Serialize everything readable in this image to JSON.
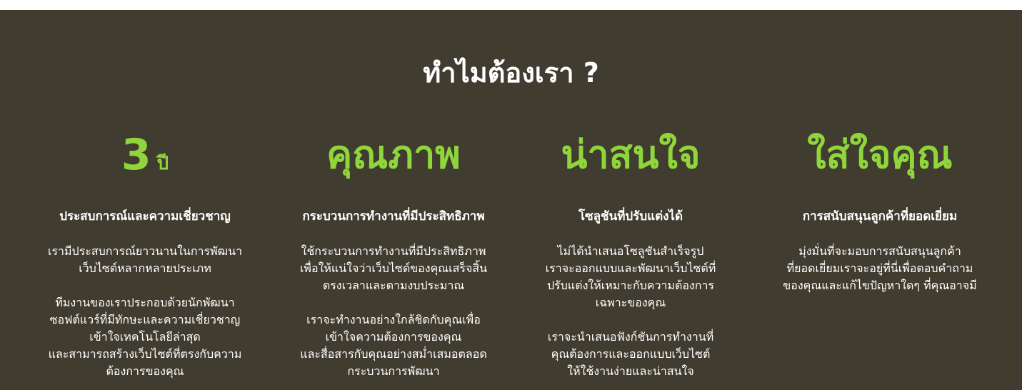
{
  "section": {
    "title": "ทำไมต้องเรา ?",
    "accent_color": "#8fd53b",
    "background_color": "#403c30"
  },
  "columns": [
    {
      "highlight_number": "3",
      "highlight_unit": "ปี",
      "subtitle": "ประสบการณ์และความเชี่ยวชาญ",
      "paragraphs": [
        [
          "เรามีประสบการณ์ยาวนานในการพัฒนา",
          "เว็บไซต์หลากหลายประเภท"
        ],
        [
          "ทีมงานของเราประกอบด้วยนักพัฒนา",
          "ซอฟต์แวร์ที่มีทักษะและความเชี่ยวชาญ",
          "เข้าใจเทคโนโลยีล่าสุด",
          "และสามารถสร้างเว็บไซต์ที่ตรงกับความ",
          "ต้องการของคุณ"
        ]
      ]
    },
    {
      "highlight": "คุณภาพ",
      "subtitle": "กระบวนการทำงานที่มีประสิทธิภาพ",
      "paragraphs": [
        [
          "ใช้กระบวนการทำงานที่มีประสิทธิภาพ",
          "เพื่อให้แน่ใจว่าเว็บไซต์ของคุณเสร็จสิ้น",
          "ตรงเวลาและตามงบประมาณ"
        ],
        [
          "เราจะทำงานอย่างใกล้ชิดกับคุณเพื่อ",
          "เข้าใจความต้องการของคุณ",
          "และสื่อสารกับคุณอย่างสม่ำเสมอตลอด",
          "กระบวนการพัฒนา"
        ]
      ]
    },
    {
      "highlight": "น่าสนใจ",
      "subtitle": "โซลูชันที่ปรับแต่งได้",
      "paragraphs": [
        [
          "ไม่ได้นำเสนอโซลูชันสำเร็จรูป",
          "เราจะออกแบบและพัฒนาเว็บไซต์ที่",
          "ปรับแต่งให้เหมาะกับความต้องการ",
          "เฉพาะของคุณ"
        ],
        [
          "เราจะนำเสนอฟังก์ชันการทำงานที่",
          "คุณต้องการและออกแบบเว็บไซต์",
          "ให้ใช้งานง่ายและน่าสนใจ"
        ]
      ]
    },
    {
      "highlight": "ใส่ใจคุณ",
      "subtitle": "การสนับสนุนลูกค้าที่ยอดเยี่ยม",
      "paragraphs": [
        [
          "มุ่งมั่นที่จะมอบการสนับสนุนลูกค้า",
          "ที่ยอดเยี่ยมเราจะอยู่ที่นี่เพื่อตอบคำถาม",
          "ของคุณและแก้ไขปัญหาใดๆ ที่คุณอาจมี"
        ]
      ]
    }
  ]
}
